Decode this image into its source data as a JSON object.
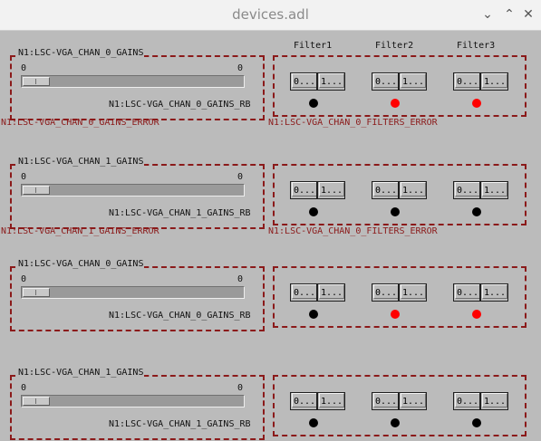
{
  "window": {
    "title": "devices.adl"
  },
  "filter_headers": [
    "Filter1",
    "Filter2",
    "Filter3"
  ],
  "colors": {
    "on": "#ff0000",
    "off": "#000000",
    "error": "#8b1a1a"
  },
  "rows": [
    {
      "gain_label": "N1:LSC-VGA_CHAN_0_GAINS",
      "min": "0",
      "max": "0",
      "readback": "N1:LSC-VGA_CHAN_0_GAINS_RB",
      "gain_error": "N1:LSC-VGA_CHAN_0_GAINS_ERROR",
      "filters_error": "N1:LSC-VGA_CHAN_0_FILTERS_ERROR",
      "filters": [
        {
          "a": "0...",
          "b": "1...",
          "state": "off"
        },
        {
          "a": "0...",
          "b": "1...",
          "state": "on"
        },
        {
          "a": "0...",
          "b": "1...",
          "state": "on"
        }
      ]
    },
    {
      "gain_label": "N1:LSC-VGA_CHAN_1_GAINS",
      "min": "0",
      "max": "0",
      "readback": "N1:LSC-VGA_CHAN_1_GAINS_RB",
      "gain_error": "N1:LSC-VGA_CHAN_1_GAINS_ERROR",
      "filters_error": "N1:LSC-VGA_CHAN_0_FILTERS_ERROR",
      "filters": [
        {
          "a": "0...",
          "b": "1...",
          "state": "off"
        },
        {
          "a": "0...",
          "b": "1...",
          "state": "off"
        },
        {
          "a": "0...",
          "b": "1...",
          "state": "off"
        }
      ]
    },
    {
      "gain_label": "N1:LSC-VGA_CHAN_0_GAINS",
      "min": "0",
      "max": "0",
      "readback": "N1:LSC-VGA_CHAN_0_GAINS_RB",
      "gain_error": "",
      "filters_error": "",
      "filters": [
        {
          "a": "0...",
          "b": "1...",
          "state": "off"
        },
        {
          "a": "0...",
          "b": "1...",
          "state": "on"
        },
        {
          "a": "0...",
          "b": "1...",
          "state": "on"
        }
      ]
    },
    {
      "gain_label": "N1:LSC-VGA_CHAN_1_GAINS",
      "min": "0",
      "max": "0",
      "readback": "N1:LSC-VGA_CHAN_1_GAINS_RB",
      "gain_error": "",
      "filters_error": "",
      "filters": [
        {
          "a": "0...",
          "b": "1...",
          "state": "off"
        },
        {
          "a": "0...",
          "b": "1...",
          "state": "off"
        },
        {
          "a": "0...",
          "b": "1...",
          "state": "off"
        }
      ]
    }
  ]
}
